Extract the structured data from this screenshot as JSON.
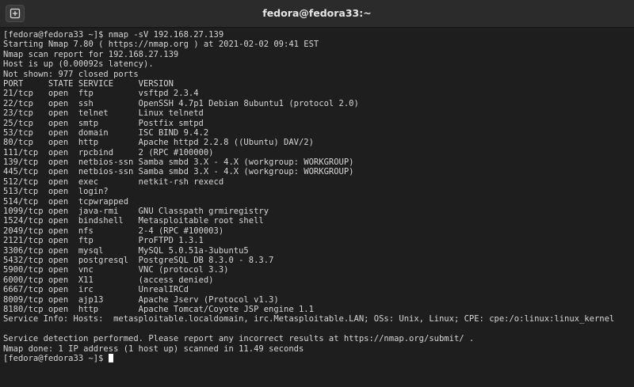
{
  "window": {
    "title": "fedora@fedora33:~"
  },
  "icons": {
    "new_tab": "new-tab-icon"
  },
  "terminal": {
    "lines": [
      "[fedora@fedora33 ~]$ nmap -sV 192.168.27.139",
      "Starting Nmap 7.80 ( https://nmap.org ) at 2021-02-02 09:41 EST",
      "Nmap scan report for 192.168.27.139",
      "Host is up (0.00092s latency).",
      "Not shown: 977 closed ports",
      "PORT     STATE SERVICE     VERSION",
      "21/tcp   open  ftp         vsftpd 2.3.4",
      "22/tcp   open  ssh         OpenSSH 4.7p1 Debian 8ubuntu1 (protocol 2.0)",
      "23/tcp   open  telnet      Linux telnetd",
      "25/tcp   open  smtp        Postfix smtpd",
      "53/tcp   open  domain      ISC BIND 9.4.2",
      "80/tcp   open  http        Apache httpd 2.2.8 ((Ubuntu) DAV/2)",
      "111/tcp  open  rpcbind     2 (RPC #100000)",
      "139/tcp  open  netbios-ssn Samba smbd 3.X - 4.X (workgroup: WORKGROUP)",
      "445/tcp  open  netbios-ssn Samba smbd 3.X - 4.X (workgroup: WORKGROUP)",
      "512/tcp  open  exec        netkit-rsh rexecd",
      "513/tcp  open  login?",
      "514/tcp  open  tcpwrapped",
      "1099/tcp open  java-rmi    GNU Classpath grmiregistry",
      "1524/tcp open  bindshell   Metasploitable root shell",
      "2049/tcp open  nfs         2-4 (RPC #100003)",
      "2121/tcp open  ftp         ProFTPD 1.3.1",
      "3306/tcp open  mysql       MySQL 5.0.51a-3ubuntu5",
      "5432/tcp open  postgresql  PostgreSQL DB 8.3.0 - 8.3.7",
      "5900/tcp open  vnc         VNC (protocol 3.3)",
      "6000/tcp open  X11         (access denied)",
      "6667/tcp open  irc         UnrealIRCd",
      "8009/tcp open  ajp13       Apache Jserv (Protocol v1.3)",
      "8180/tcp open  http        Apache Tomcat/Coyote JSP engine 1.1",
      "Service Info: Hosts:  metasploitable.localdomain, irc.Metasploitable.LAN; OSs: Unix, Linux; CPE: cpe:/o:linux:linux_kernel",
      "",
      "Service detection performed. Please report any incorrect results at https://nmap.org/submit/ .",
      "Nmap done: 1 IP address (1 host up) scanned in 11.49 seconds"
    ],
    "prompt": "[fedora@fedora33 ~]$ "
  }
}
